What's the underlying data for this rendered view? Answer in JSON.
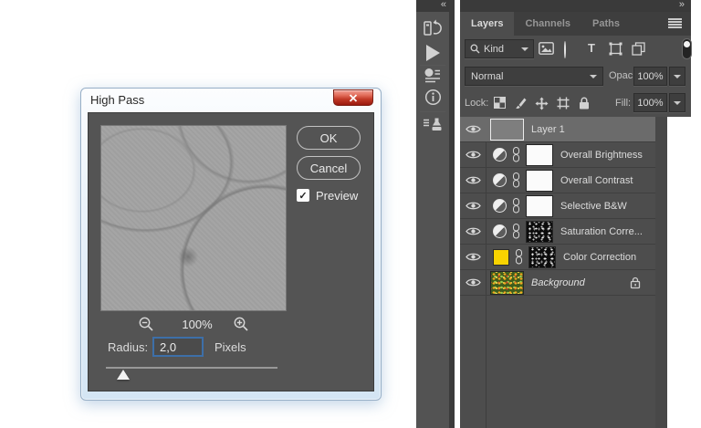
{
  "dialog": {
    "title": "High Pass",
    "ok_label": "OK",
    "cancel_label": "Cancel",
    "preview_label": "Preview",
    "preview_checked": true,
    "zoom_level": "100%",
    "radius_label": "Radius:",
    "radius_value": "2,0",
    "radius_unit": "Pixels"
  },
  "panel": {
    "tabs": [
      {
        "label": "Layers",
        "active": true
      },
      {
        "label": "Channels",
        "active": false
      },
      {
        "label": "Paths",
        "active": false
      }
    ],
    "kind_label": "Kind",
    "blend_mode": "Normal",
    "opacity_label": "Opacity:",
    "opacity_value": "100%",
    "lock_label": "Lock:",
    "fill_label": "Fill:",
    "fill_value": "100%",
    "layers": [
      {
        "name": "Layer 1",
        "kind": "pixel",
        "selected": true
      },
      {
        "name": "Overall Brightness",
        "kind": "adjustment",
        "mask": "white"
      },
      {
        "name": "Overall Contrast",
        "kind": "adjustment",
        "mask": "white"
      },
      {
        "name": "Selective B&W",
        "kind": "adjustment",
        "mask": "white"
      },
      {
        "name": "Saturation Corre...",
        "kind": "adjustment",
        "mask": "speckled"
      },
      {
        "name": "Color Correction",
        "kind": "fill",
        "swatch": "#f8d300",
        "mask": "speckled"
      },
      {
        "name": "Background",
        "kind": "background",
        "locked": true
      }
    ]
  },
  "colors": {
    "panel_bg": "#4d4d4d",
    "selected_row": "#6b6b6b",
    "dialog_bg": "#545454",
    "accent_blue": "#3d6fa8",
    "swatch_yellow": "#f8d300",
    "close_button_red": "#c23a28",
    "aero_frame": "#d4e5f4"
  }
}
